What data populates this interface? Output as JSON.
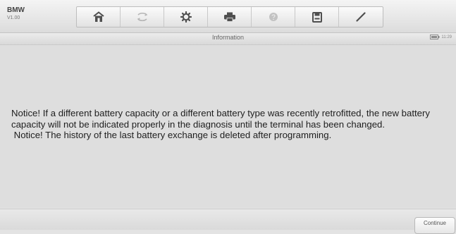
{
  "header": {
    "brand": "BMW",
    "version": "V1.00"
  },
  "toolbar": {
    "buttons": [
      {
        "icon": "home-icon",
        "enabled": true
      },
      {
        "icon": "vehicle-swap-icon",
        "enabled": false
      },
      {
        "icon": "settings-icon",
        "enabled": true
      },
      {
        "icon": "print-icon",
        "enabled": true
      },
      {
        "icon": "help-icon",
        "enabled": false
      },
      {
        "icon": "save-icon",
        "enabled": true
      },
      {
        "icon": "edit-icon",
        "enabled": true
      }
    ]
  },
  "page": {
    "title": "Information",
    "status_text": "11:29"
  },
  "message": {
    "lines": [
      "Notice! If a different battery capacity or a different battery type was recently retrofitted, the new battery capacity will not be indicated properly in the diagnosis until the terminal has been changed.",
      " Notice! The history of the last battery exchange is deleted after programming."
    ]
  },
  "footer": {
    "continue_label": "Continue"
  },
  "colors": {
    "active_icon": "#4f4f4f",
    "disabled_icon": "#b5b5b5",
    "background": "#dedede"
  }
}
